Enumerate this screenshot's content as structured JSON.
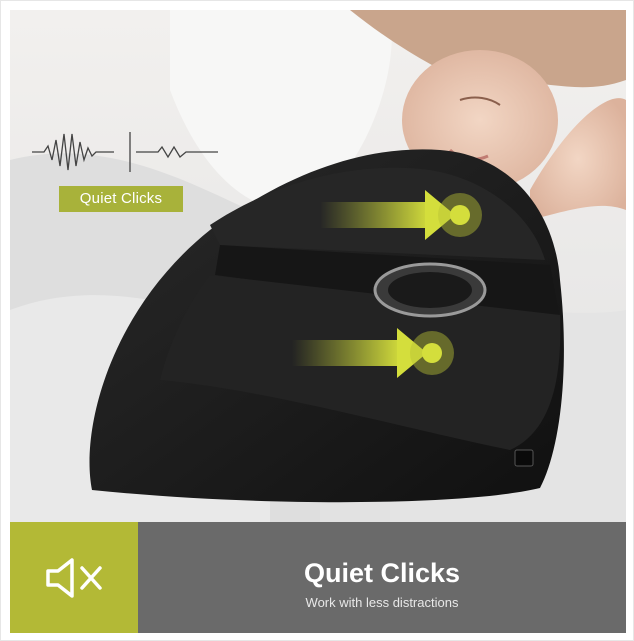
{
  "badge": {
    "label": "Quiet Clicks"
  },
  "footer": {
    "title": "Quiet Clicks",
    "subtitle": "Work with less distractions",
    "icon": "speaker-mute-icon"
  },
  "colors": {
    "accent": "#b3b936",
    "panel": "#6a6a6a",
    "mouse": "#1c1c1c"
  }
}
